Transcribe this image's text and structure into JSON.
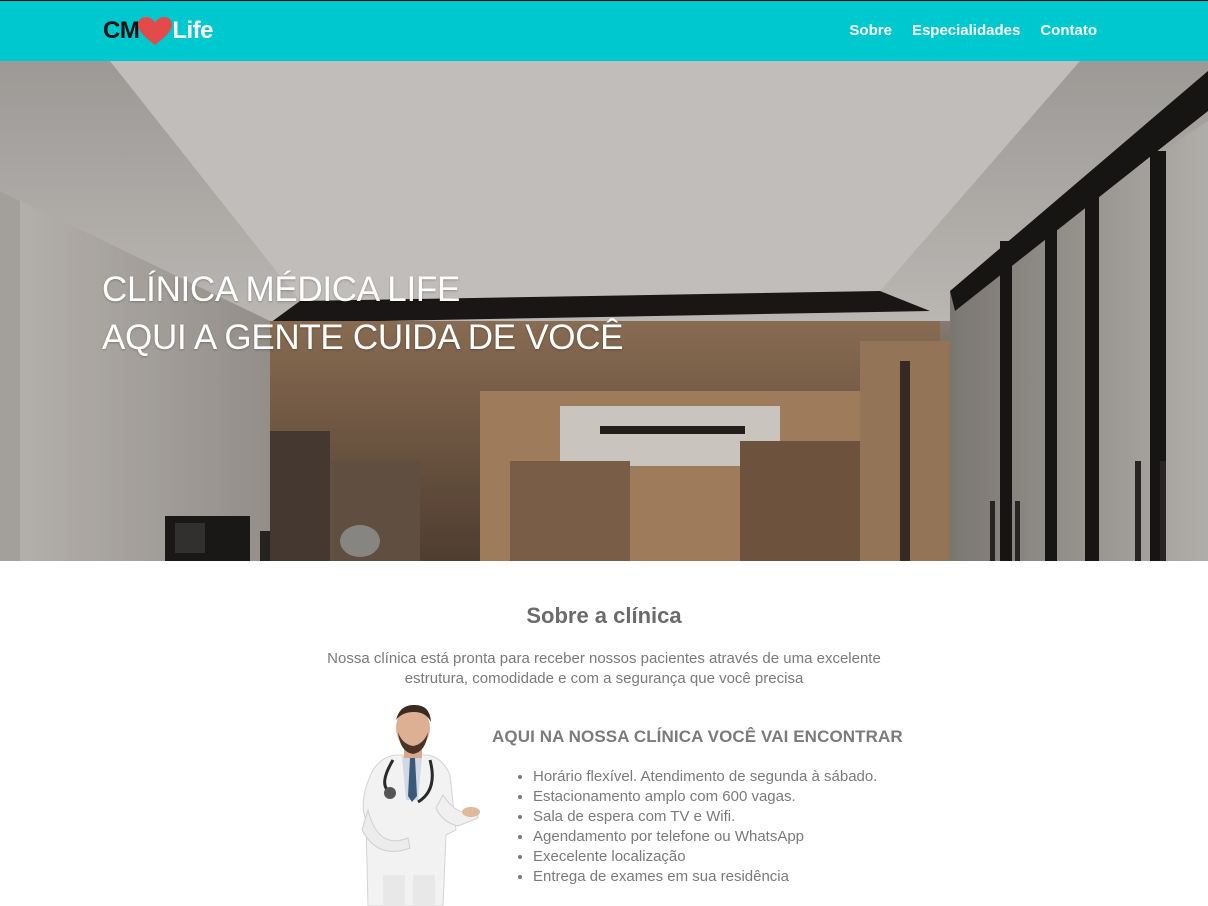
{
  "header": {
    "logo": {
      "part1": "CM",
      "part2": "Life",
      "icon": "heart-icon",
      "heart_color": "#e34b4b"
    },
    "bg_color": "#00c8cf",
    "nav": [
      {
        "label": "Sobre"
      },
      {
        "label": "Especialidades"
      },
      {
        "label": "Contato"
      }
    ]
  },
  "hero": {
    "line1": "CLÍNICA MÉDICA LIFE",
    "line2": "AQUI A GENTE CUIDA DE VOCÊ",
    "image": "clinic-lobby-photo"
  },
  "about": {
    "title": "Sobre a clínica",
    "description": "Nossa clínica está pronta para receber nossos pacientes através de uma excelente estrutura, comodidade e com a segurança que você precisa",
    "image": "doctor-photo",
    "features_title": "AQUI NA NOSSA CLÍNICA VOCÊ VAI ENCONTRAR",
    "features": [
      "Horário flexível. Atendimento de segunda à sábado.",
      "Estacionamento amplo com 600 vagas.",
      "Sala de espera com TV e Wifi.",
      "Agendamento por telefone ou WhatsApp",
      "Execelente localização",
      "Entrega de exames em sua residência"
    ]
  }
}
